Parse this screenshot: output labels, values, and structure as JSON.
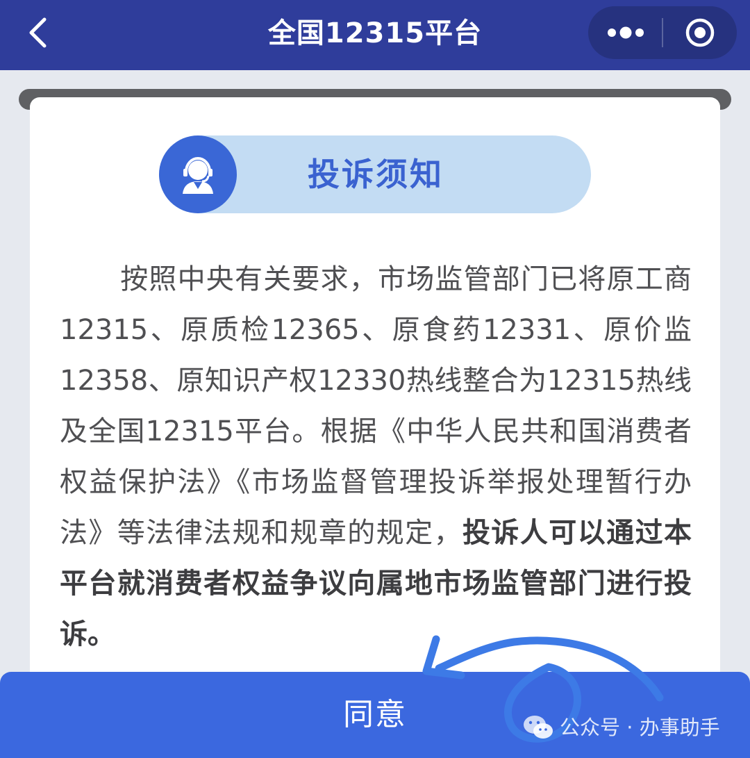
{
  "header": {
    "title": "全国12315平台",
    "back_icon": "chevron-left-icon",
    "more_icon": "more-dots-icon",
    "close_icon": "target-circle-icon",
    "background": "#2f3d9b"
  },
  "notice": {
    "title": "投诉须知",
    "avatar_icon": "customer-service-icon",
    "pill_color": "#c3dcf3",
    "avatar_color": "#3a67d6",
    "paragraph_normal": "按照中央有关要求，市场监管部门已将原工商12315、原质检12365、原食药12331、原价监12358、原知识产权12330热线整合为12315热线及全国12315平台。根据《中华人民共和国消费者权益保护法》《市场监督管理投诉举报处理暂行办法》等法律法规和规章的规定，",
    "paragraph_bold": "投诉人可以通过本平台就消费者权益争议向属地市场监管部门进行投诉。"
  },
  "footer": {
    "agree_label": "同意",
    "button_color": "#3b68df"
  },
  "watermark": {
    "text": "公众号 · 办事助手",
    "icon": "wechat-icon"
  }
}
